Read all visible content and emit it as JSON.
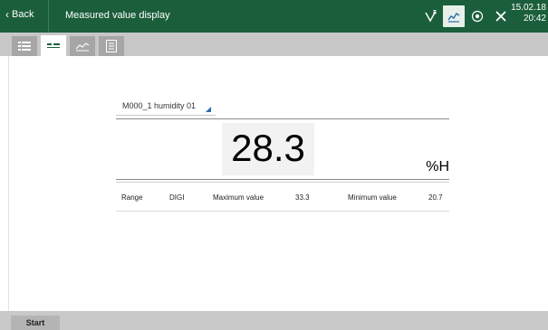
{
  "header": {
    "back_label": "Back",
    "title": "Measured value display",
    "date": "15.02.18",
    "time": "20:42",
    "toolbar_icons": [
      "sensor-connect-icon",
      "chart-icon",
      "registration-icon",
      "tools-icon"
    ],
    "accent_color": "#1b5e3b"
  },
  "tabs": [
    "list-view-icon",
    "single-value-icon",
    "chart-view-icon",
    "report-icon"
  ],
  "main": {
    "channel_selector": "M000_1 humidity 01",
    "value": "28.3",
    "unit": "%H",
    "stats": {
      "range_label": "Range",
      "range_value": "DIGI",
      "max_label": "Maximum value",
      "max_value": "33.3",
      "min_label": "Minimum value",
      "min_value": "20.7"
    }
  },
  "footer": {
    "start_label": "Start"
  }
}
